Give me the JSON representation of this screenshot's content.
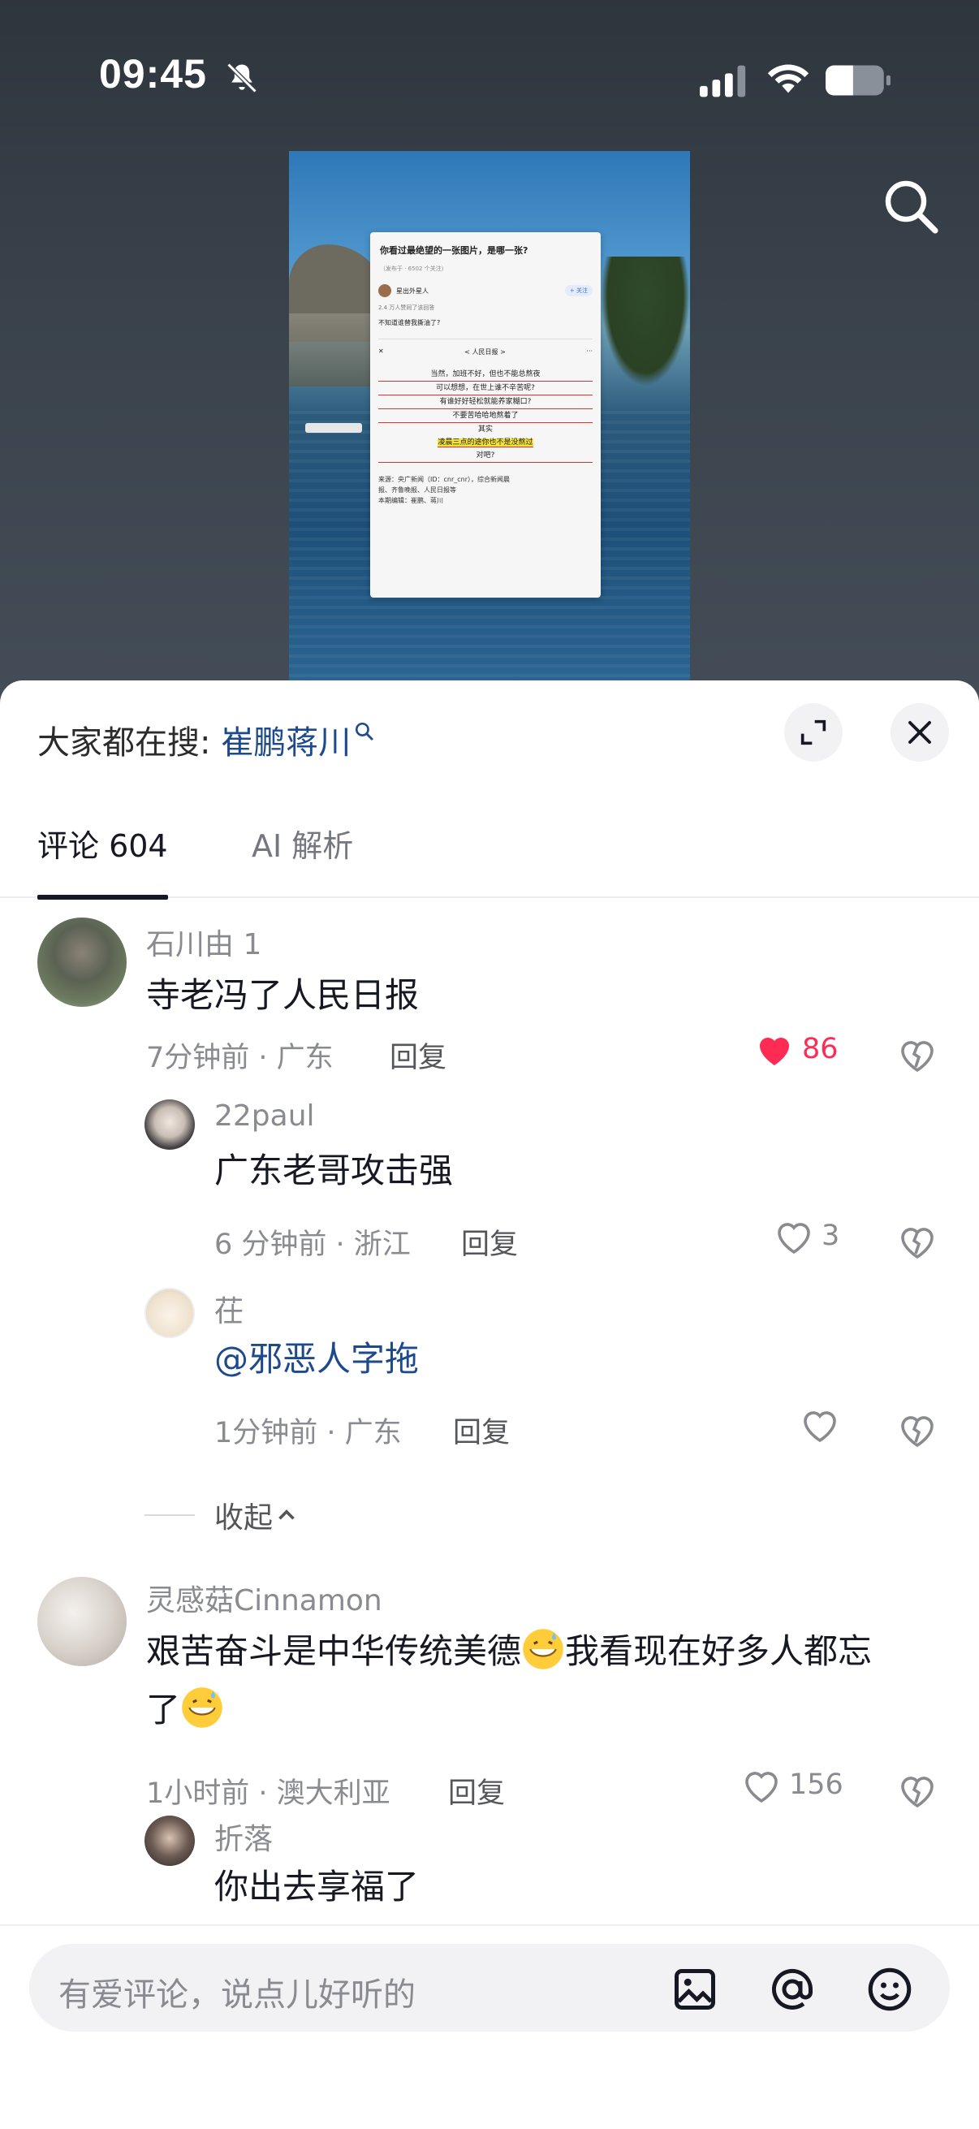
{
  "status_bar": {
    "time": "09:45"
  },
  "video": {
    "card_title": "你看过最绝望的一张图片，是哪一张?",
    "card_meta": "（发布于 · 6502 个关注）",
    "author": "星出外星人",
    "follow_label": "+ 关注",
    "card_small": "2.4 万人赞同了该回答",
    "card_line": "不知道谁替我撕油了?",
    "bar_title": "< 人民日报 >",
    "quote_lines": [
      "当然，加班不好，但也不能总熬夜",
      "可以想想，在世上谁不辛苦呢?",
      "有谁好好轻松就能养家糊口?",
      "不要苦哈哈地熬着了",
      "其实",
      "凌晨三点的途你也不是没熬过",
      "对吧?"
    ],
    "footer_lines": [
      "来源：央广新闻（ID：cnr_cnr），综合新闻晨",
      "报、齐鲁晚报、人民日报等",
      "本期编辑：崔鹏、蒋川"
    ]
  },
  "sheet": {
    "search_prefix": "大家都在搜: ",
    "search_keyword": "崔鹏蒋川",
    "tabs": [
      {
        "label": "评论 604",
        "active": true
      },
      {
        "label": "AI 解析",
        "active": false
      }
    ]
  },
  "comments": [
    {
      "username": "石川由 1",
      "text": "寺老冯了人民日报",
      "time_location": "7分钟前 · 广东",
      "reply_label": "回复",
      "likes": "86",
      "liked": true
    },
    {
      "username": "22paul",
      "text": "广东老哥攻击强",
      "time_location": "6 分钟前 · 浙江",
      "reply_label": "回复",
      "likes": "3"
    },
    {
      "username": "茌",
      "text": "@邪恶人字拖",
      "time_location": "1分钟前 · 广东",
      "reply_label": "回复",
      "likes": ""
    },
    {
      "username": "灵感菇Cinnamon",
      "text_line1": "艰苦奋斗是中华传统美德",
      "text_line1b": "我看现在好多人都忘",
      "text_line2": "了",
      "time_location": "1小时前 · 澳大利亚",
      "reply_label": "回复",
      "likes": "156"
    },
    {
      "username": "折落",
      "text": "你出去享福了"
    }
  ],
  "collapse_label": "收起",
  "input": {
    "placeholder": "有爱评论，说点儿好听的"
  },
  "colors": {
    "like_active": "#fe2c55",
    "link": "#1d4a8c",
    "muted": "#8a8b91"
  },
  "icons": [
    "bell-off-icon",
    "signal-icon",
    "wifi-icon",
    "battery-icon",
    "search-icon",
    "expand-icon",
    "close-icon",
    "heart-icon",
    "broken-heart-icon",
    "chevron-up-icon",
    "image-icon",
    "at-icon",
    "emoji-icon"
  ]
}
